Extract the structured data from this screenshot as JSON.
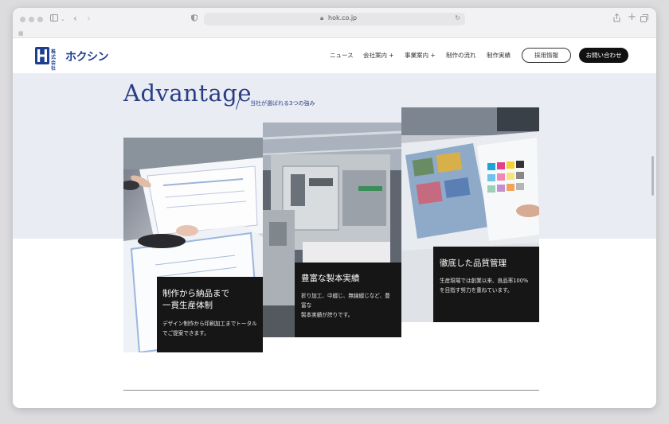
{
  "browser": {
    "url": "hok.co.jp",
    "icons": [
      "sidebar-icon",
      "back-icon",
      "forward-icon",
      "shield-icon",
      "lock-icon",
      "reload-icon",
      "share-icon",
      "new-tab-icon",
      "tabs-overview-icon",
      "extensions-icon"
    ]
  },
  "header": {
    "logo_sub_line1": "株式",
    "logo_sub_line2": "会社",
    "logo_name": "ホクシン",
    "nav": [
      {
        "label": "ニュース"
      },
      {
        "label": "会社案内 +"
      },
      {
        "label": "事業案内 +"
      },
      {
        "label": "制作の流れ"
      },
      {
        "label": "制作実績"
      }
    ],
    "recruit_button": "採用情報",
    "contact_button": "お問い合わせ"
  },
  "section": {
    "title": "Advantage",
    "subtitle": "当社が選ばれる3つの強み"
  },
  "cards": [
    {
      "heading_line1": "制作から納品まで",
      "heading_line2": "一貫生産体制",
      "body_line1": "デザイン制作から印刷加工までトータル",
      "body_line2": "でご提案できます。"
    },
    {
      "heading_line1": "豊富な製本実績",
      "body_line1": "折り加工、中綴じ、無線綴じなど、豊富な",
      "body_line2": "製本実績が誇りです。"
    },
    {
      "heading_line1": "徹底した品質管理",
      "body_line1": "生産現場では創業以来、良品率100%",
      "body_line2": "を目指す努力を重ねています。"
    }
  ],
  "colors": {
    "brand": "#1e3f8f",
    "band": "#e9ecf3",
    "card_box": "#161616"
  }
}
